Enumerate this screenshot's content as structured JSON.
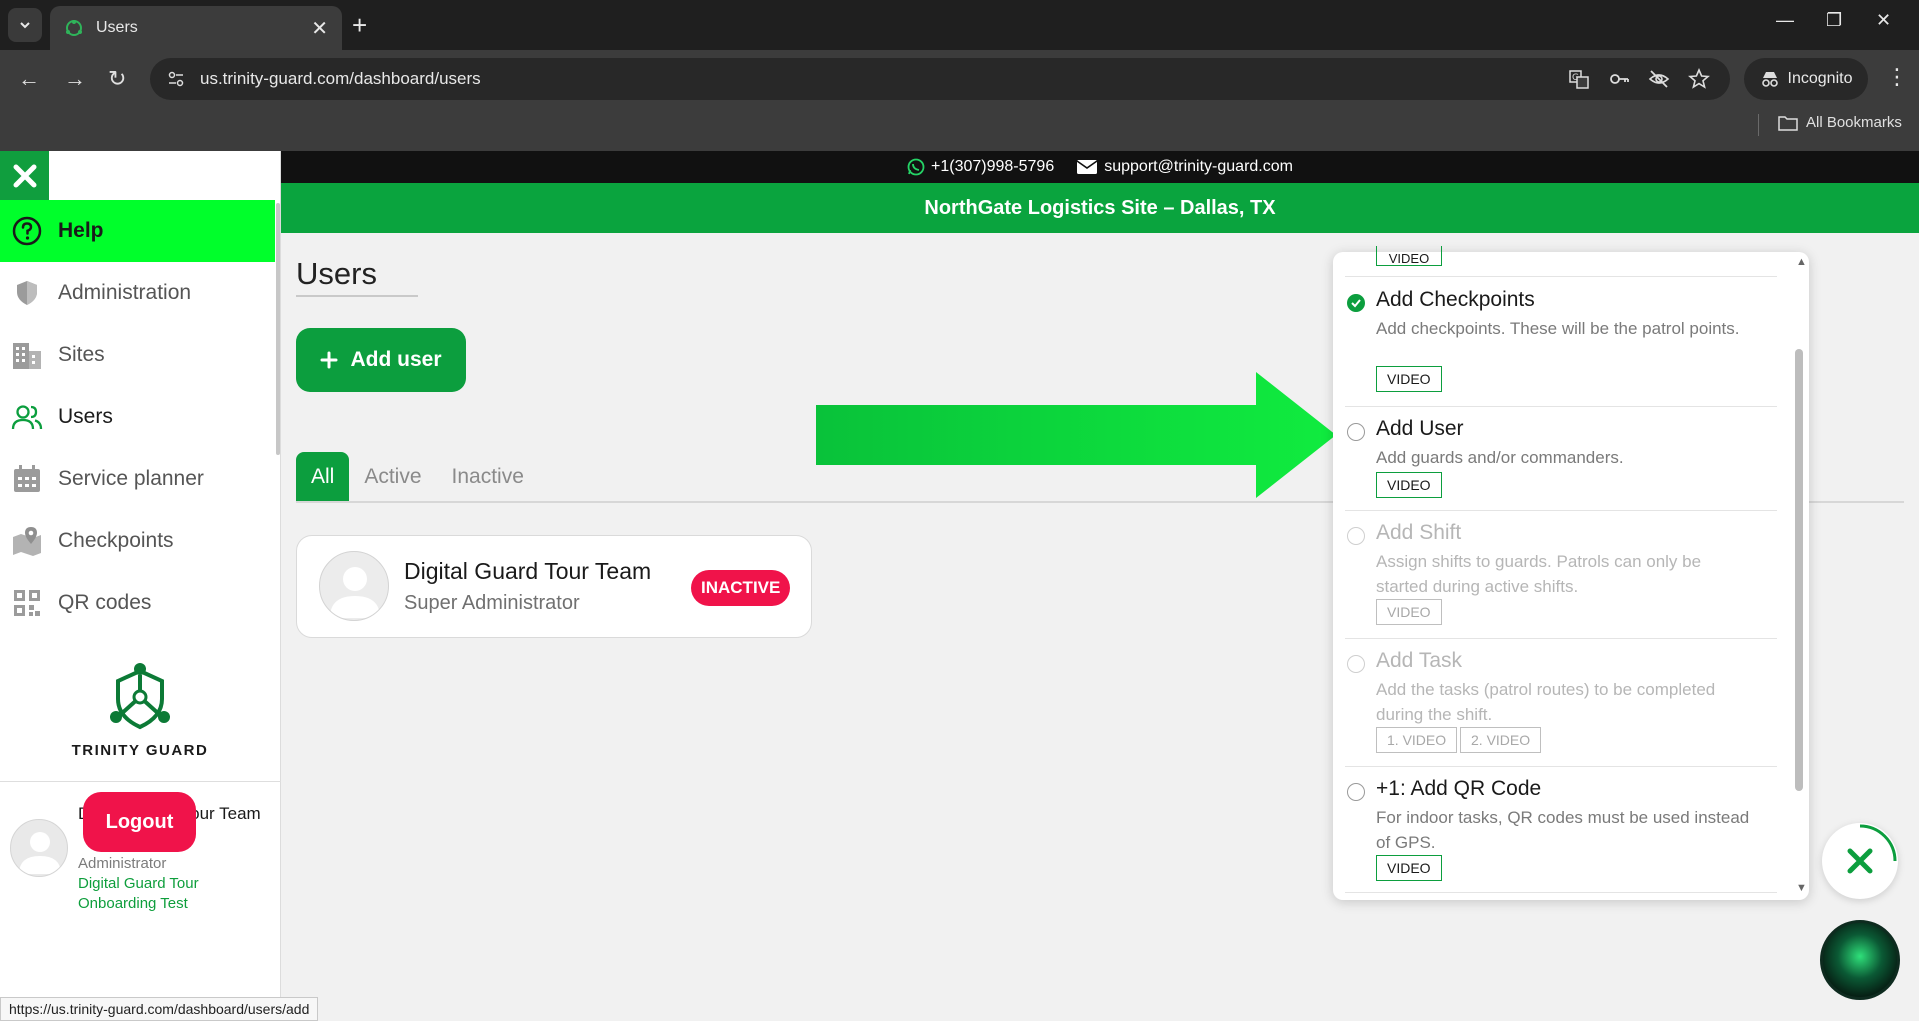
{
  "browser": {
    "tab_title": "Users",
    "url_text": "us.trinity-guard.com/dashboard/users",
    "incognito_label": "Incognito",
    "bookmarks_label": "All Bookmarks",
    "status_url": "https://us.trinity-guard.com/dashboard/users/add"
  },
  "contact": {
    "phone": "+1(307)998-5796",
    "email": "support@trinity-guard.com"
  },
  "site_name": "NorthGate Logistics Site – Dallas, TX",
  "sidebar": {
    "items": [
      {
        "label": "Help",
        "icon": "help-circle-icon"
      },
      {
        "label": "Administration",
        "icon": "shield-icon"
      },
      {
        "label": "Sites",
        "icon": "building-icon"
      },
      {
        "label": "Users",
        "icon": "users-icon"
      },
      {
        "label": "Service planner",
        "icon": "calendar-icon"
      },
      {
        "label": "Checkpoints",
        "icon": "map-pin-icon"
      },
      {
        "label": "QR codes",
        "icon": "qr-code-icon"
      }
    ],
    "brand_name": "TRINITY GUARD",
    "user": {
      "name": "Digital Guard Tour Team",
      "role": "Administrator",
      "org": "Digital Guard Tour Onboarding Test"
    },
    "logout_label": "Logout"
  },
  "main": {
    "title": "Users",
    "add_user_label": "Add user",
    "tabs": [
      "All",
      "Active",
      "Inactive"
    ],
    "user_card": {
      "name": "Digital Guard Tour Team",
      "role": "Super Administrator",
      "status": "INACTIVE"
    }
  },
  "onboarding": {
    "top_video_label": "VIDEO",
    "steps": [
      {
        "title": "Add Checkpoints",
        "desc": "Add checkpoints. These will be the patrol points.",
        "videos": [
          "VIDEO"
        ],
        "done": true
      },
      {
        "title": "Add User",
        "desc": "Add guards and/or commanders.",
        "videos": [
          "VIDEO"
        ],
        "done": false
      },
      {
        "title": "Add Shift",
        "desc": "Assign shifts to guards. Patrols can only be started during active shifts.",
        "videos": [
          "VIDEO"
        ],
        "done": false
      },
      {
        "title": "Add Task",
        "desc": "Add the tasks (patrol routes) to be completed during the shift.",
        "videos": [
          "1. VIDEO",
          "2. VIDEO"
        ],
        "done": false
      },
      {
        "title": "+1: Add QR Code",
        "desc": "For indoor tasks, QR codes must be used instead of GPS.",
        "videos": [
          "VIDEO"
        ],
        "done": false
      }
    ]
  },
  "colors": {
    "brand_green": "#0c9e3e",
    "help_green": "#00ff2b",
    "danger": "#f0134a",
    "arrow_green": "#0be03c"
  }
}
